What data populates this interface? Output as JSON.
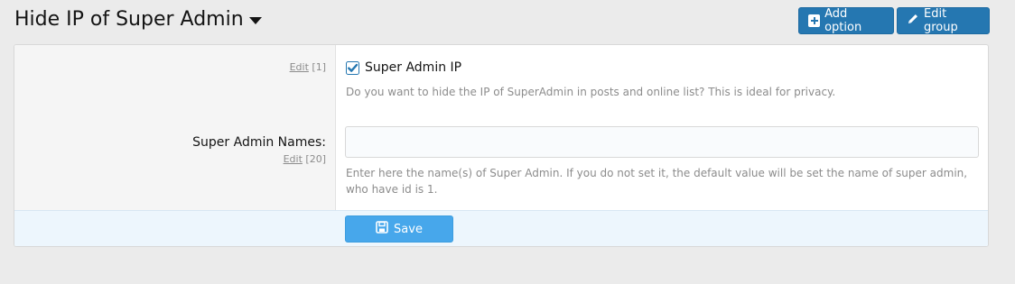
{
  "header": {
    "title": "Hide IP of Super Admin",
    "add_option_label": "Add option",
    "edit_group_label": "Edit group"
  },
  "options": {
    "super_admin_ip": {
      "edit_text": "Edit",
      "edit_count": "[1]",
      "label": "Super Admin IP",
      "checked": true,
      "hint": "Do you want to hide the IP of SuperAdmin in posts and online list? This is ideal for privacy."
    },
    "super_admin_names": {
      "label": "Super Admin Names:",
      "edit_text": "Edit",
      "edit_count": "[20]",
      "value": "",
      "hint": "Enter here the name(s) of Super Admin. If you do not set it, the default value will be set the name of super admin, who have id is 1."
    }
  },
  "footer": {
    "save_label": "Save"
  },
  "colors": {
    "primary": "#2577b1",
    "save": "#47a7eb",
    "checkbox": "#2577b1"
  }
}
